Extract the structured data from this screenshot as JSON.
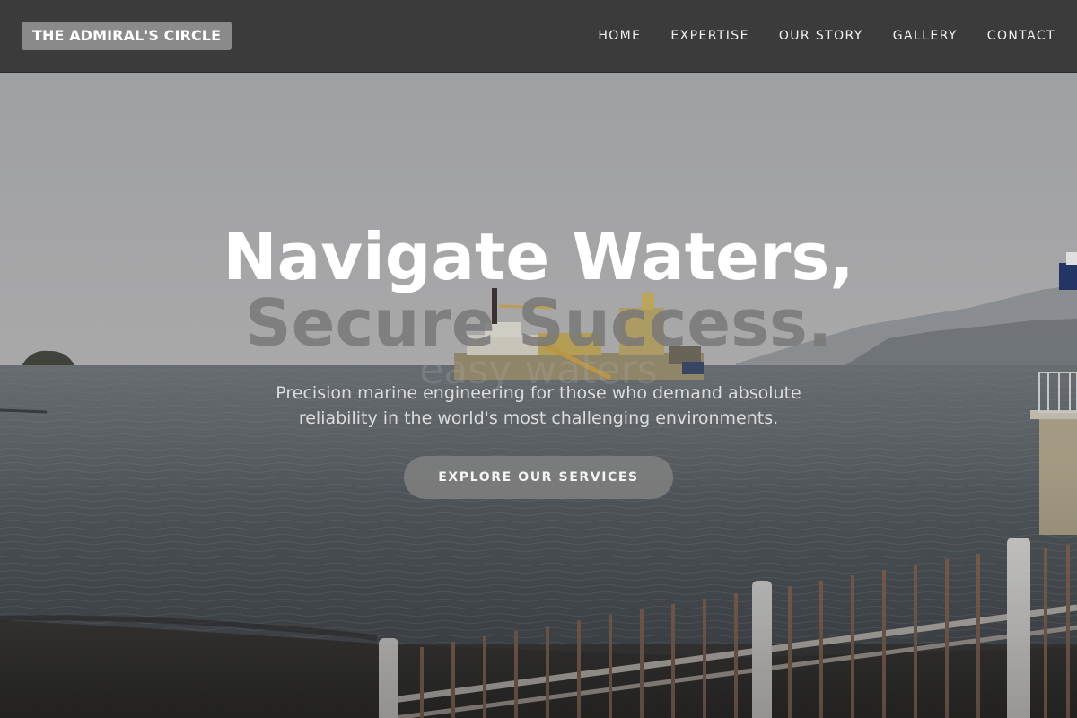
{
  "brand": {
    "logo_text": "THE ADMIRAL'S CIRCLE"
  },
  "nav": {
    "items": [
      {
        "label": "HOME"
      },
      {
        "label": "EXPERTISE"
      },
      {
        "label": "OUR STORY"
      },
      {
        "label": "GALLERY"
      },
      {
        "label": "CONTACT"
      }
    ]
  },
  "hero": {
    "title_line1": "Navigate Waters,",
    "title_line2": "Secure Success.",
    "ghost_text": "easy waters",
    "subtitle": "Precision marine engineering for those who demand absolute reliability in the world's most challenging environments.",
    "cta_label": "EXPLORE OUR SERVICES",
    "background_image": "coastal-harbor-dredging-ship-photo"
  },
  "colors": {
    "header_bg": "#3b3b3b",
    "logo_bg": "#8a8a8a",
    "cta_bg": "#808080",
    "title_primary": "#ffffff",
    "title_secondary": "#787878"
  }
}
